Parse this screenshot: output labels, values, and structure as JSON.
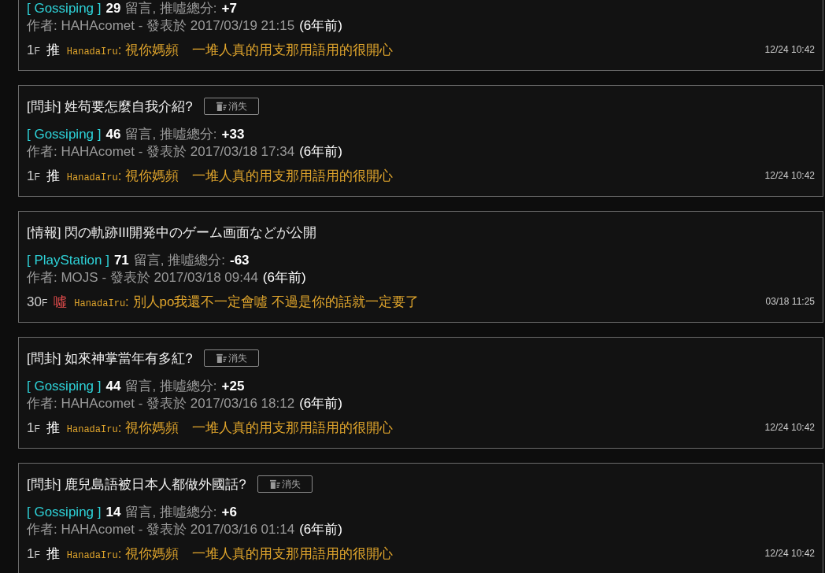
{
  "posts": [
    {
      "board": "[ Gossiping ]",
      "comment_count": "29",
      "comment_label": "留言, 推噓總分:",
      "score": "+7",
      "author_line": "作者: HAHAcomet - 發表於 2017/03/19 21:15",
      "age": "(6年前)",
      "comment": {
        "floor": "1",
        "floor_unit": "F",
        "kind": "push",
        "tag": "推",
        "user": "HanadaIru",
        "content": ": 視你媽頻　一堆人真的用支那用語用的很開心",
        "time": "12/24 10:42"
      }
    },
    {
      "title": "[問卦] 姓苟要怎麼自我介紹?",
      "hide_button": "消失",
      "board": "[ Gossiping ]",
      "comment_count": "46",
      "comment_label": "留言, 推噓總分:",
      "score": "+33",
      "author_line": "作者: HAHAcomet - 發表於 2017/03/18 17:34",
      "age": "(6年前)",
      "comment": {
        "floor": "1",
        "floor_unit": "F",
        "kind": "push",
        "tag": "推",
        "user": "HanadaIru",
        "content": ": 視你媽頻　一堆人真的用支那用語用的很開心",
        "time": "12/24 10:42"
      }
    },
    {
      "title": "[情報] 閃の軌跡III開発中のゲーム画面などが公開",
      "board": "[ PlayStation ]",
      "comment_count": "71",
      "comment_label": "留言, 推噓總分:",
      "score": "-63",
      "author_line": "作者: MOJS - 發表於 2017/03/18 09:44",
      "age": "(6年前)",
      "comment": {
        "floor": "30",
        "floor_unit": "F",
        "kind": "boo",
        "tag": "噓",
        "user": "HanadaIru",
        "content": ": 別人po我還不一定會噓 不過是你的話就一定要了",
        "time": "03/18 11:25"
      }
    },
    {
      "title": "[問卦] 如來神掌當年有多紅?",
      "hide_button": "消失",
      "board": "[ Gossiping ]",
      "comment_count": "44",
      "comment_label": "留言, 推噓總分:",
      "score": "+25",
      "author_line": "作者: HAHAcomet - 發表於 2017/03/16 18:12",
      "age": "(6年前)",
      "comment": {
        "floor": "1",
        "floor_unit": "F",
        "kind": "push",
        "tag": "推",
        "user": "HanadaIru",
        "content": ": 視你媽頻　一堆人真的用支那用語用的很開心",
        "time": "12/24 10:42"
      }
    },
    {
      "title": "[問卦] 鹿兒島語被日本人都做外國話?",
      "hide_button": "消失",
      "board": "[ Gossiping ]",
      "comment_count": "14",
      "comment_label": "留言, 推噓總分:",
      "score": "+6",
      "author_line": "作者: HAHAcomet - 發表於 2017/03/16 01:14",
      "age": "(6年前)",
      "comment": {
        "floor": "1",
        "floor_unit": "F",
        "kind": "push",
        "tag": "推",
        "user": "HanadaIru",
        "content": ": 視你媽頻　一堆人真的用支那用語用的很開心",
        "time": "12/24 10:42"
      }
    }
  ]
}
